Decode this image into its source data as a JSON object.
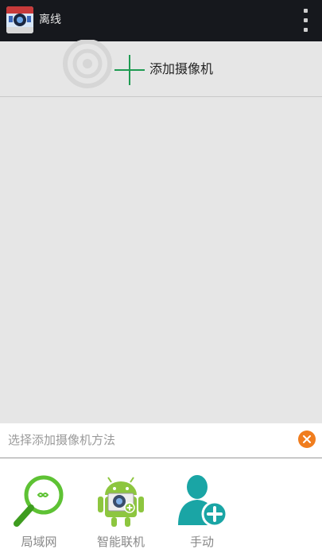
{
  "appbar": {
    "logo_icon": "camera-app-logo-icon",
    "title": "离线",
    "overflow_icon": "overflow-menu-icon"
  },
  "main": {
    "add_camera_label": "添加摄像机",
    "add_icon": "plus-icon"
  },
  "sheet": {
    "title": "选择添加摄像机方法",
    "close_icon": "close-icon",
    "options": [
      {
        "label": "局域网",
        "icon": "lan-search-icon"
      },
      {
        "label": "智能联机",
        "icon": "android-camera-icon"
      },
      {
        "label": "手动",
        "icon": "add-user-icon"
      }
    ]
  },
  "colors": {
    "appbar_bg": "#16181d",
    "accent_green": "#1f9b52",
    "close_orange": "#f07d1e",
    "teal": "#1aa5a5"
  }
}
